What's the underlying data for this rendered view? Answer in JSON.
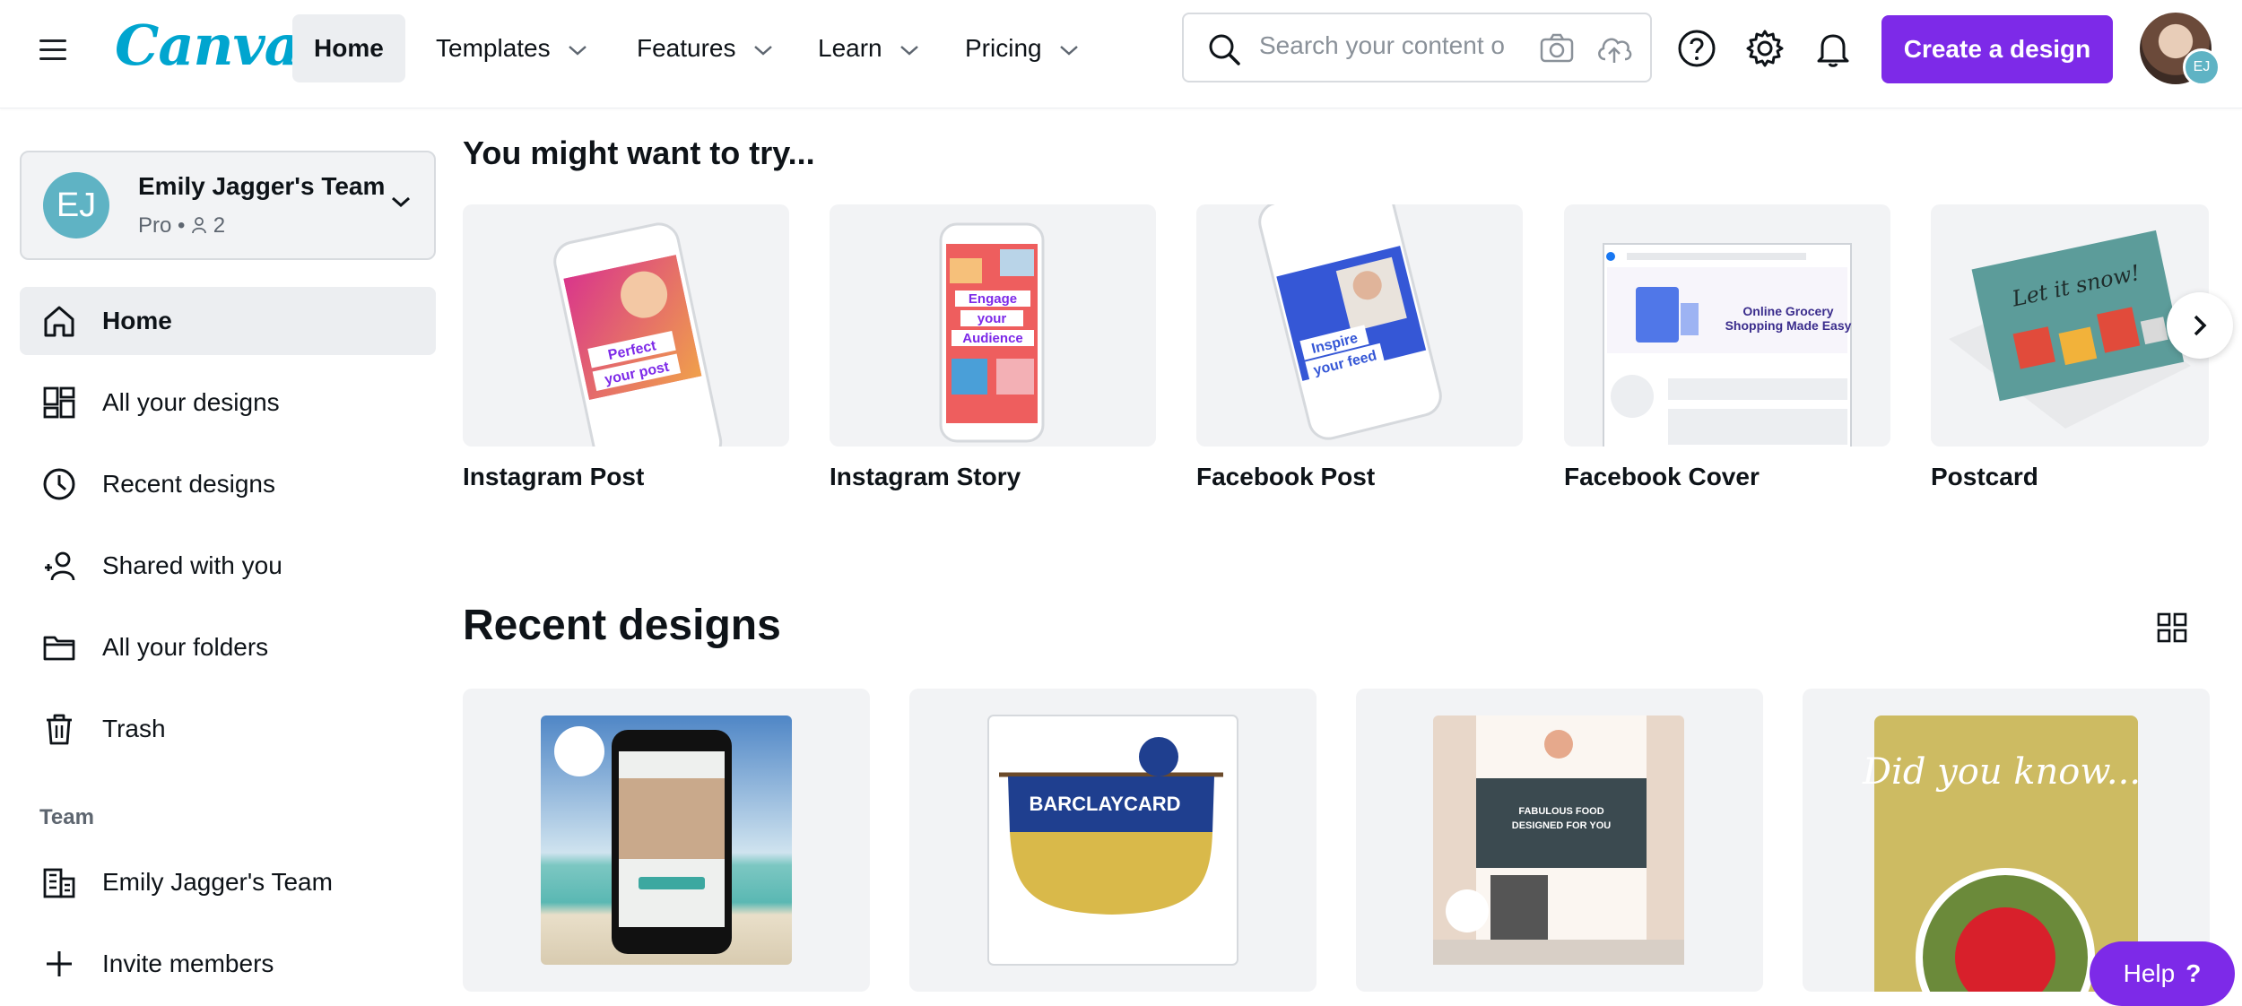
{
  "app": {
    "logo": "Canva"
  },
  "nav": {
    "items": [
      {
        "label": "Home",
        "active": true,
        "has_dropdown": false
      },
      {
        "label": "Templates",
        "active": false,
        "has_dropdown": true
      },
      {
        "label": "Features",
        "active": false,
        "has_dropdown": true
      },
      {
        "label": "Learn",
        "active": false,
        "has_dropdown": true
      },
      {
        "label": "Pricing",
        "active": false,
        "has_dropdown": true
      }
    ],
    "search_placeholder": "Search your content o",
    "create_label": "Create a design",
    "avatar_badge": "EJ"
  },
  "team": {
    "avatar": "EJ",
    "name": "Emily Jagger's Team",
    "plan": "Pro",
    "members": "2"
  },
  "sidebar": {
    "items": [
      {
        "label": "Home",
        "icon": "home-icon",
        "active": true
      },
      {
        "label": "All your designs",
        "icon": "grid-layout-icon",
        "active": false
      },
      {
        "label": "Recent designs",
        "icon": "clock-icon",
        "active": false
      },
      {
        "label": "Shared with you",
        "icon": "people-icon",
        "active": false
      },
      {
        "label": "All your folders",
        "icon": "folder-icon",
        "active": false
      },
      {
        "label": "Trash",
        "icon": "trash-icon",
        "active": false
      }
    ],
    "team_heading": "Team",
    "team_items": [
      {
        "label": "Emily Jagger's Team",
        "icon": "building-icon"
      },
      {
        "label": "Invite members",
        "icon": "plus-icon"
      }
    ]
  },
  "try_section": {
    "title": "You might want to try...",
    "cards": [
      {
        "label": "Instagram Post",
        "thumb_text": "Perfect your post"
      },
      {
        "label": "Instagram Story",
        "thumb_text": "Engage your Audience"
      },
      {
        "label": "Facebook Post",
        "thumb_text": "Inspire your feed"
      },
      {
        "label": "Facebook Cover",
        "thumb_text": "Online Grocery Shopping Made Easy"
      },
      {
        "label": "Postcard",
        "thumb_text": "Let it snow!"
      }
    ]
  },
  "recent": {
    "title": "Recent designs",
    "designs": [
      {
        "text": ""
      },
      {
        "text": "BARCLAYCARD"
      },
      {
        "text": "FABULOUS FOOD DESIGNED FOR YOU"
      },
      {
        "text": "Did you know..."
      }
    ]
  },
  "help": {
    "label": "Help",
    "mark": "?"
  },
  "colors": {
    "accent": "#7d2ae8",
    "logo": "#00a5cf",
    "team_avatar": "#5fb3c4"
  }
}
